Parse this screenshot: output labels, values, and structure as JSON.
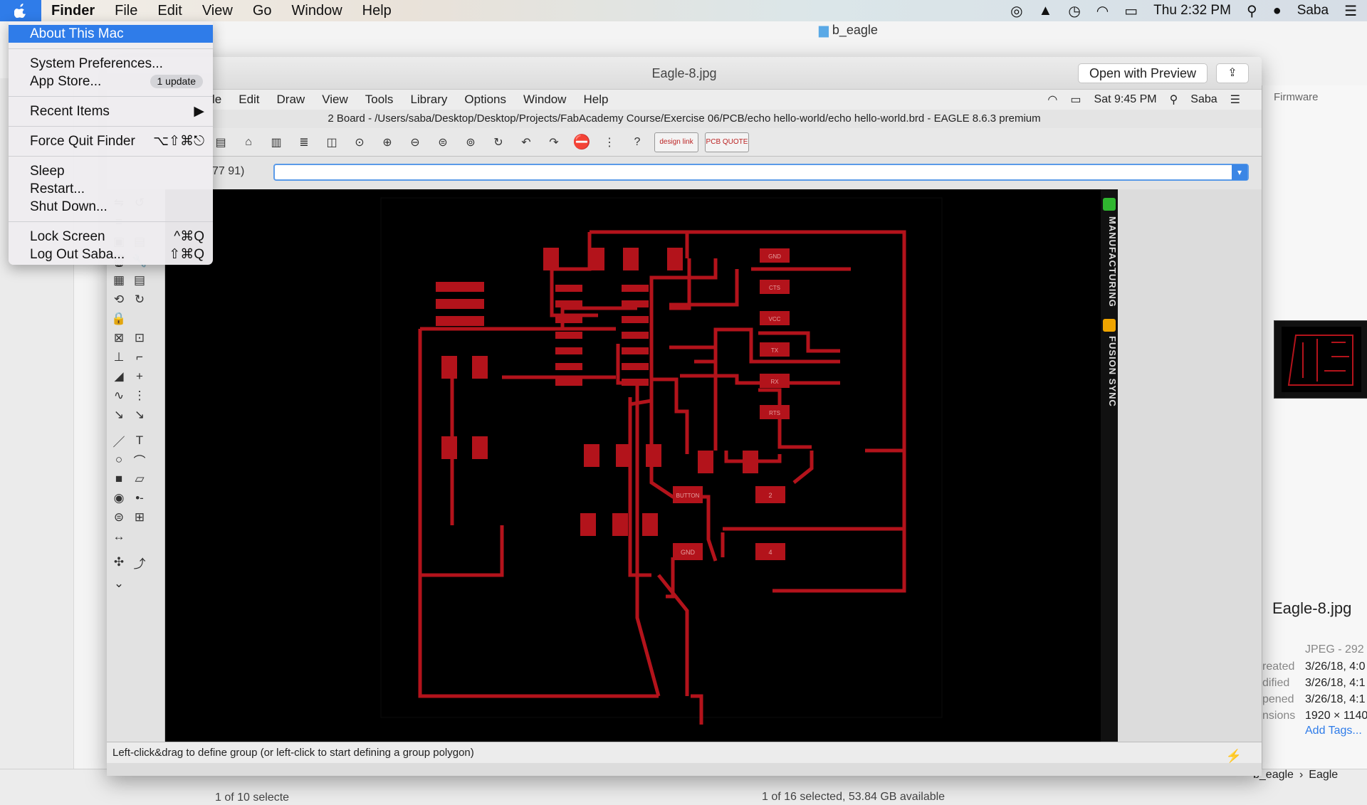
{
  "menubar": {
    "app": "Finder",
    "items": [
      "File",
      "Edit",
      "View",
      "Go",
      "Window",
      "Help"
    ],
    "clock": "Thu 2:32 PM",
    "user": "Saba"
  },
  "apple_menu": {
    "about": "About This Mac",
    "system_prefs": "System Preferences...",
    "app_store": "App Store...",
    "app_store_badge": "1 update",
    "recent_items": "Recent Items",
    "force_quit": "Force Quit Finder",
    "force_quit_shortcut": "⌥⇧⌘⎋",
    "sleep": "Sleep",
    "restart": "Restart...",
    "shut_down": "Shut Down...",
    "lock_screen": "Lock Screen",
    "lock_shortcut": "^⌘Q",
    "log_out": "Log Out Saba...",
    "logout_shortcut": "⇧⌘Q"
  },
  "finder": {
    "window_title": "b_eagle",
    "status": "1 of 16 selected, 53.84 GB available",
    "status_left": "1 of 10 selecte",
    "path_right": [
      "b_eagle",
      "Eagle"
    ]
  },
  "preview": {
    "title": "Eagle-8.jpg",
    "open_button": "Open with Preview"
  },
  "preview_pane": {
    "section": "Firmware",
    "file_name": "Eagle-8.jpg",
    "kind": "JPEG - 292",
    "created_label": "reated",
    "created": "3/26/18, 4:0",
    "modified_label": "dified",
    "modified": "3/26/18, 4:1",
    "opened_label": "pened",
    "opened": "3/26/18, 4:1",
    "dims_label": "nsions",
    "dims": "1920 × 1140",
    "add_tags": "Add Tags..."
  },
  "eagle": {
    "menu": [
      "le",
      "Edit",
      "Draw",
      "View",
      "Tools",
      "Library",
      "Options",
      "Window",
      "Help"
    ],
    "clock": "Sat 9:45 PM",
    "user": "Saba",
    "title": "2 Board - /Users/saba/Desktop/Desktop/Projects/FabAcademy Course/Exercise 06/PCB/echo hello-world/echo hello-world.brd - EAGLE 8.6.3 premium",
    "coords": "77 91)",
    "status": "Left-click&drag to define group (or left-click to start defining a group polygon)",
    "tab_manufacturing": "MANUFACTURING",
    "tab_fusion": "FUSION SYNC",
    "design_link": "design link",
    "pcb_quote": "PCB QUOTE",
    "pad_labels": {
      "gnd": "GND",
      "cts": "CTS",
      "vcc": "VCC",
      "tx": "TX",
      "rx": "RX",
      "rts": "RTS",
      "button": "BUTTON",
      "gnd2": "GND",
      "two": "2",
      "four": "4"
    }
  },
  "colors": {
    "trace": "#b3131b",
    "selection": "#2f7ce9",
    "board_bg": "#000000"
  }
}
